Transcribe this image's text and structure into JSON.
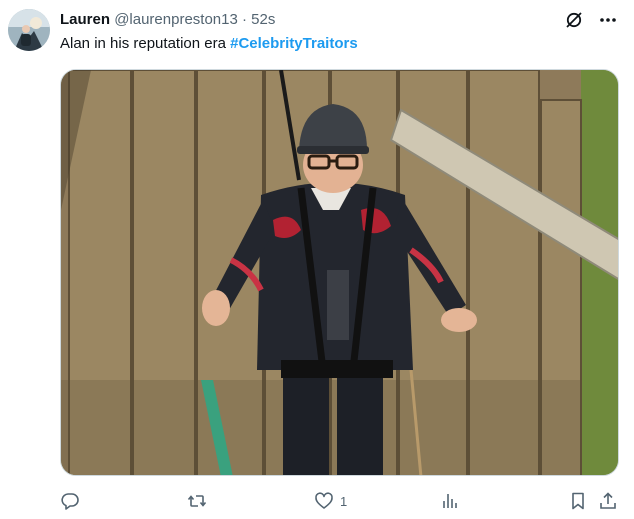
{
  "tweet": {
    "author_name": "Lauren",
    "author_handle": "@laurenpreston13",
    "separator": "·",
    "time": "52s",
    "text": "Alan in his reputation era ",
    "hashtag": "#CelebrityTraitors",
    "media_subject": "man in helmet and harness on wooden platform"
  },
  "actions": {
    "reply_count": "",
    "retweet_count": "",
    "like_count": "1",
    "views_count": ""
  },
  "icons": {
    "grok": "grok-icon",
    "more": "more-icon",
    "reply": "reply-icon",
    "retweet": "retweet-icon",
    "like": "like-icon",
    "views": "views-icon",
    "bookmark": "bookmark-icon",
    "share": "share-icon"
  },
  "colors": {
    "text": "#0f1419",
    "muted": "#536471",
    "link": "#1d9bf0"
  }
}
